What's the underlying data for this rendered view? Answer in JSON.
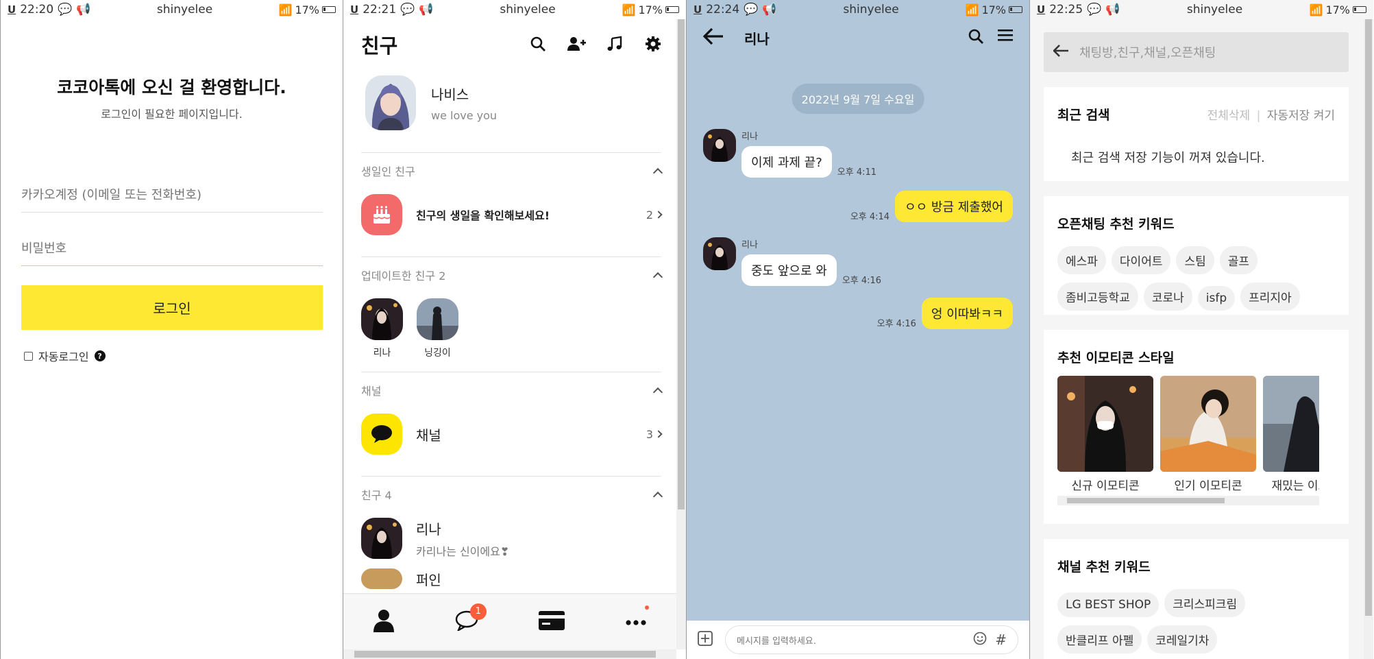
{
  "common": {
    "user": "shinyelee",
    "battery": "17%"
  },
  "p1": {
    "time": "22:20",
    "welcome": "코코아톡에 오신 걸 환영합니다.",
    "sub": "로그인이 필요한 페이지입니다.",
    "email_placeholder": "카카오계정 (이메일 또는 전화번호)",
    "password_placeholder": "비밀번호",
    "login_label": "로그인",
    "auto_login": "자동로그인"
  },
  "p2": {
    "time": "22:21",
    "title": "친구",
    "me": {
      "name": "나비스",
      "message": "we love you"
    },
    "birthday_header": "생일인 친구",
    "birthday_text": "친구의 생일을 확인해보세요!",
    "birthday_count": "2",
    "updated_header": "업데이트한 친구 2",
    "updated": [
      {
        "name": "리나"
      },
      {
        "name": "닝깅이"
      }
    ],
    "channel_header": "채널",
    "channel_label": "채널",
    "channel_count": "3",
    "friends_header": "친구 4",
    "friends": [
      {
        "name": "리나",
        "status": "카리나는 신이에요❣"
      },
      {
        "name": "퍼인"
      }
    ],
    "chat_badge": "1"
  },
  "p3": {
    "time": "22:24",
    "partner": "리나",
    "date": "2022년 9월 7일 수요일",
    "messages": [
      {
        "sender": "리나",
        "text": "이제 과제 끝?",
        "time": "오후 4:11"
      },
      {
        "text": "ㅇㅇ 방금 제출했어",
        "time": "오후 4:14"
      },
      {
        "sender": "리나",
        "text": "중도 앞으로 와",
        "time": "오후 4:16"
      },
      {
        "text": "엉 이따봐ㅋㅋ",
        "time": "오후 4:16"
      }
    ],
    "input_placeholder": "메시지를 입력하세요."
  },
  "p4": {
    "time": "22:25",
    "search_placeholder": "채팅방,친구,채널,오픈채팅",
    "recent_title": "최근 검색",
    "delete_all": "전체삭제",
    "autosave": "자동저장 켜기",
    "recent_notice": "최근 검색 저장 기능이 꺼져 있습니다.",
    "open_title": "오픈채팅 추천 키워드",
    "open_keywords": [
      "에스파",
      "다이어트",
      "스팀",
      "골프",
      "좀비고등학교",
      "코로나",
      "isfp",
      "프리지아"
    ],
    "emoticon_title": "추천 이모티콘 스타일",
    "emoticons": [
      "신규 이모티콘",
      "인기 이모티콘",
      "재밌는 이모티콘"
    ],
    "channel_title": "채널 추천 키워드",
    "channel_keywords": [
      "LG BEST SHOP",
      "크리스피크림",
      "반클리프 아펠",
      "코레일기차"
    ]
  }
}
